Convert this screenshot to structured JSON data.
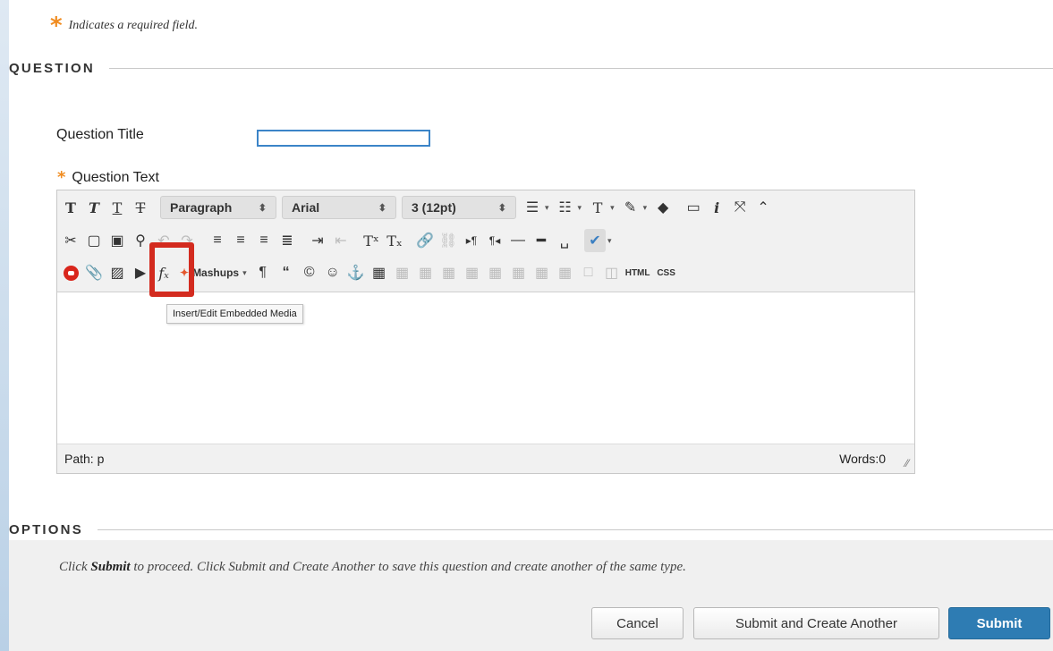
{
  "required_note": {
    "symbol": "*",
    "text": "Indicates a required field."
  },
  "sections": {
    "question": "QUESTION",
    "options": "OPTIONS"
  },
  "question_title": {
    "label": "Question Title",
    "value": ""
  },
  "question_text": {
    "label": "Question Text",
    "required_symbol": "*"
  },
  "editor": {
    "toolbar_row1": {
      "format_dropdown": "Paragraph",
      "font_dropdown": "Arial",
      "size_dropdown": "3 (12pt)"
    },
    "toolbar_row3": {
      "mashups": "Mashups",
      "html_button": "HTML",
      "css_button": "CSS"
    },
    "tooltip": "Insert/Edit Embedded Media",
    "status": {
      "path": "Path: p",
      "words": "Words:0"
    }
  },
  "footer": {
    "message_before": "Click ",
    "message_bold": "Submit",
    "message_after": " to proceed. Click Submit and Create Another to save this question and create another of the same type.",
    "buttons": {
      "cancel": "Cancel",
      "submit_another": "Submit and Create Another",
      "submit": "Submit"
    }
  },
  "colors": {
    "accent_orange": "#f08c20",
    "submit_blue": "#2e7cb3",
    "highlight_red": "#d32b1f",
    "input_border": "#3b84c8"
  }
}
